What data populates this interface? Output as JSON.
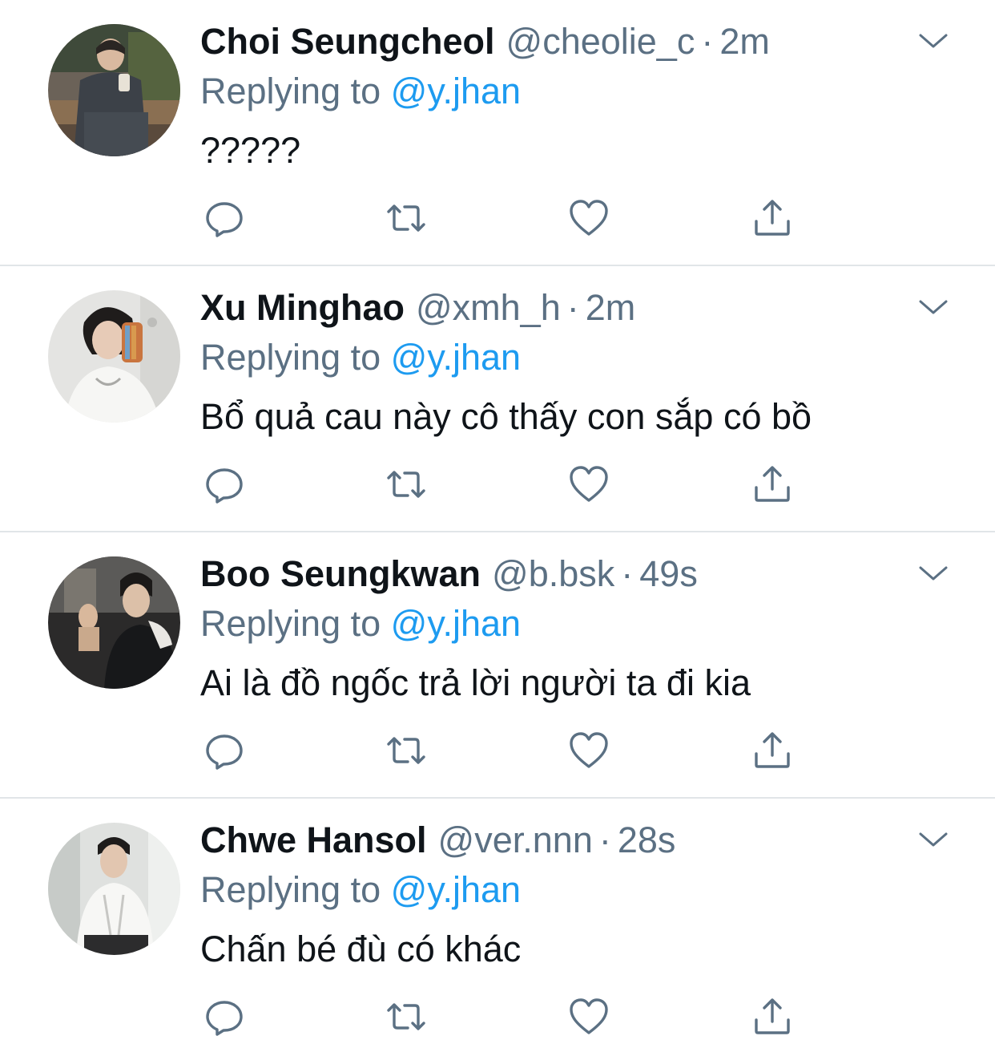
{
  "tweets": [
    {
      "name": "Choi Seungcheol",
      "handle": "@cheolie_c",
      "separator": "·",
      "time": "2m",
      "replying_prefix": "Replying to",
      "replying_to": "@y.jhan",
      "text": "?????"
    },
    {
      "name": "Xu Minghao",
      "handle": "@xmh_h",
      "separator": "·",
      "time": "2m",
      "replying_prefix": "Replying to",
      "replying_to": "@y.jhan",
      "text": "Bổ quả cau này cô thấy con sắp có bồ"
    },
    {
      "name": "Boo Seungkwan",
      "handle": "@b.bsk",
      "separator": "·",
      "time": "49s",
      "replying_prefix": "Replying to",
      "replying_to": "@y.jhan",
      "text": "Ai là đồ ngốc trả lời người ta đi kia"
    },
    {
      "name": "Chwe Hansol",
      "handle": "@ver.nnn",
      "separator": "·",
      "time": "28s",
      "replying_prefix": "Replying to",
      "replying_to": "@y.jhan",
      "text": "Chấn bé đù có khác"
    }
  ],
  "icons": {
    "reply": "speech-bubble-icon",
    "retweet": "retweet-icon",
    "like": "heart-icon",
    "share": "share-icon",
    "more": "chevron-down-icon"
  },
  "colors": {
    "text": "#0f1419",
    "secondary": "#5b7083",
    "link": "#1d9bf0",
    "divider": "#e1e5e8"
  }
}
